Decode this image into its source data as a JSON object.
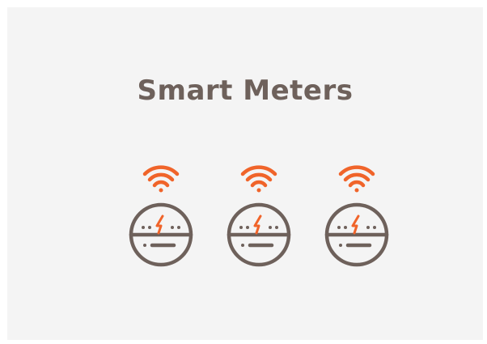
{
  "title": "Smart Meters",
  "colors": {
    "background": "#f4f4f4",
    "title": "#6e615b",
    "meter_outline": "#6e615b",
    "signal_accent": "#f0642a"
  },
  "meters": [
    {
      "icon": "smart-meter-icon",
      "signal_icon": "wifi-signal-icon",
      "symbol_icon": "lightning-bolt-icon"
    },
    {
      "icon": "smart-meter-icon",
      "signal_icon": "wifi-signal-icon",
      "symbol_icon": "lightning-bolt-icon"
    },
    {
      "icon": "smart-meter-icon",
      "signal_icon": "wifi-signal-icon",
      "symbol_icon": "lightning-bolt-icon"
    }
  ]
}
